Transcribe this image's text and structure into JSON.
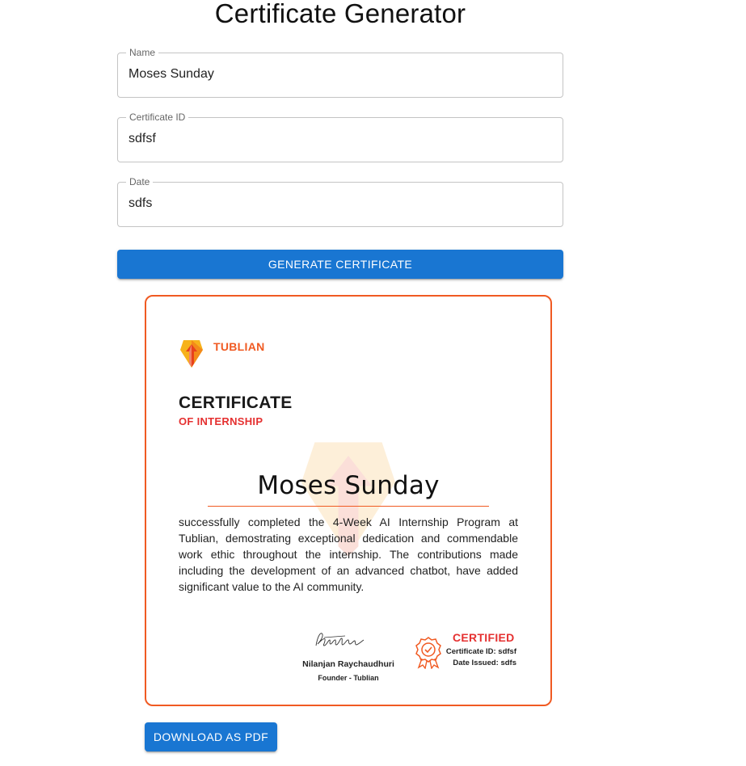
{
  "page": {
    "title": "Certificate Generator"
  },
  "form": {
    "name": {
      "label": "Name",
      "value": "Moses Sunday"
    },
    "certificate_id": {
      "label": "Certificate ID",
      "value": "sdfsf"
    },
    "date": {
      "label": "Date",
      "value": "sdfs"
    },
    "generate_label": "Generate Certificate"
  },
  "certificate": {
    "brand": "TUBLIAN",
    "title": "CERTIFICATE",
    "subtitle": "OF INTERNSHIP",
    "recipient": "Moses Sunday",
    "body": "successfully completed the 4-Week AI Internship Program at Tublian, demostrating exceptional dedication and commendable work ethic throughout the internship. The contributions made including the development of an advanced chatbot, have added significant value to the AI community.",
    "signer_name": "Nilanjan Raychaudhuri",
    "signer_role": "Founder - Tublian",
    "certified_label": "CERTIFIED",
    "certificate_id_line": "Certificate ID: sdfsf",
    "date_issued_line": "Date Issued: sdfs",
    "accent_color": "#f05a22",
    "red_color": "#e53030",
    "icons": [
      "tublian-logo-icon",
      "certified-badge-icon"
    ]
  },
  "download_label": "Download as PDF",
  "colors": {
    "primary": "#1976d2"
  }
}
